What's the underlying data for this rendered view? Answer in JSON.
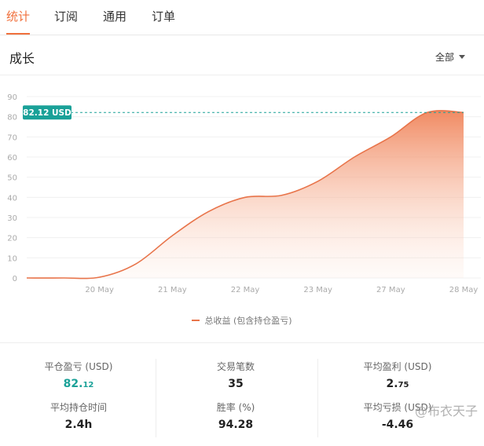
{
  "tabs": [
    {
      "label": "统计",
      "active": true
    },
    {
      "label": "订阅",
      "active": false
    },
    {
      "label": "通用",
      "active": false
    },
    {
      "label": "订单",
      "active": false
    }
  ],
  "header": {
    "title": "成长",
    "filter": "全部"
  },
  "chart_data": {
    "type": "area",
    "y_ticks": [
      "90",
      "80",
      "70",
      "60",
      "50",
      "40",
      "30",
      "20",
      "10",
      "0"
    ],
    "ylim": [
      0,
      90
    ],
    "x_labels": [
      "20 May",
      "21 May",
      "22 May",
      "23 May",
      "27 May",
      "28 May"
    ],
    "x": [
      0,
      1,
      2,
      3,
      4,
      5,
      6,
      7,
      8,
      9,
      10,
      11,
      12
    ],
    "values": [
      0,
      0,
      0.4,
      7,
      21,
      33,
      40,
      41,
      48,
      60,
      70,
      82.12,
      82.12
    ],
    "current_label": "82.12 USD",
    "current_value": 82.12,
    "series": [
      {
        "name": "总收益 (包含持仓盈亏)",
        "color": "#e8744a"
      }
    ],
    "legend": "bottom-center",
    "grid": true
  },
  "stats": {
    "closed_pnl_label": "平仓盈亏 (USD)",
    "closed_pnl_main": "82.",
    "closed_pnl_frac": "12",
    "avg_hold_label": "平均持仓时间",
    "avg_hold_value": "2.4h",
    "trades_label": "交易笔数",
    "trades_value": "35",
    "winrate_label": "胜率 (%)",
    "winrate_value": "94.28",
    "avg_profit_label": "平均盈利 (USD)",
    "avg_profit_main": "2.",
    "avg_profit_frac": "75",
    "avg_loss_label": "平均亏损 (USD)",
    "avg_loss_value": "-4.46"
  },
  "watermark": "@布衣天子"
}
